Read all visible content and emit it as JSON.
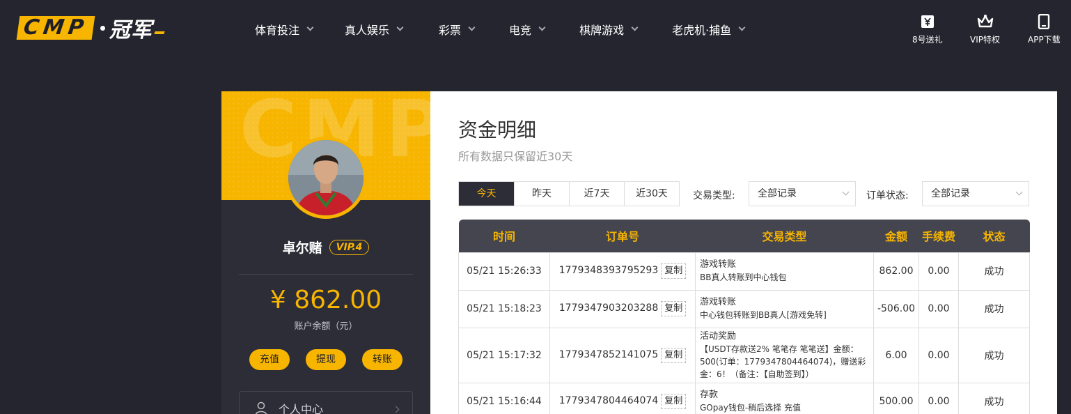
{
  "brand": {
    "logo_box": "CMP",
    "logo_text": "冠军"
  },
  "nav": {
    "items": [
      {
        "label": "体育投注"
      },
      {
        "label": "真人娱乐"
      },
      {
        "label": "彩票"
      },
      {
        "label": "电竞"
      },
      {
        "label": "棋牌游戏"
      },
      {
        "label": "老虎机·捕鱼"
      }
    ]
  },
  "utilities": [
    {
      "label": "8号送礼",
      "icon": "gift-yen-icon"
    },
    {
      "label": "VIP特权",
      "icon": "crown-icon"
    },
    {
      "label": "APP下载",
      "icon": "mobile-phone-icon"
    }
  ],
  "profile": {
    "hero_watermark": "CMP",
    "username": "卓尔赌",
    "vip_badge": "VIP.4",
    "balance": "¥ 862.00",
    "balance_label": "账户余额（元）",
    "actions": [
      "充值",
      "提现",
      "转账"
    ],
    "menu_item": "个人中心"
  },
  "page": {
    "title": "资金明细",
    "subtitle": "所有数据只保留近30天"
  },
  "filters": {
    "day_tabs": [
      "今天",
      "昨天",
      "近7天",
      "近30天"
    ],
    "selected_day_tab": "今天",
    "type_label": "交易类型:",
    "type_value": "全部记录",
    "status_label": "订单状态:",
    "status_value": "全部记录"
  },
  "table": {
    "headers": [
      "时间",
      "订单号",
      "交易类型",
      "金额",
      "手续费",
      "状态"
    ],
    "copy_label": "复制",
    "rows": [
      {
        "time": "05/21 15:26:33",
        "order": "1779348393795293",
        "type": "游戏转账",
        "desc": "BB真人转账到中心钱包",
        "amount": "862.00",
        "fee": "0.00",
        "status": "成功"
      },
      {
        "time": "05/21 15:18:23",
        "order": "1779347903203288",
        "type": "游戏转账",
        "desc": "中心钱包转账到BB真人[游戏免转]",
        "amount": "-506.00",
        "fee": "0.00",
        "status": "成功"
      },
      {
        "time": "05/21 15:17:32",
        "order": "1779347852141075",
        "type": "活动奖励",
        "desc": "【USDT存款送2% 笔笔存 笔笔送】金额：500(订单：1779347804464074)，赠送彩金：6！（备注：【自助签到】）",
        "amount": "6.00",
        "fee": "0.00",
        "status": "成功"
      },
      {
        "time": "05/21 15:16:44",
        "order": "1779347804464074",
        "type": "存款",
        "desc": "GOpay钱包-稍后选择 充值",
        "amount": "500.00",
        "fee": "0.00",
        "status": "成功"
      }
    ]
  },
  "colors": {
    "accent": "#f7b500",
    "background": "#25252f",
    "panel_dark": "#2d2d38",
    "header_row": "#45454f",
    "success": "#3a9d2a"
  }
}
